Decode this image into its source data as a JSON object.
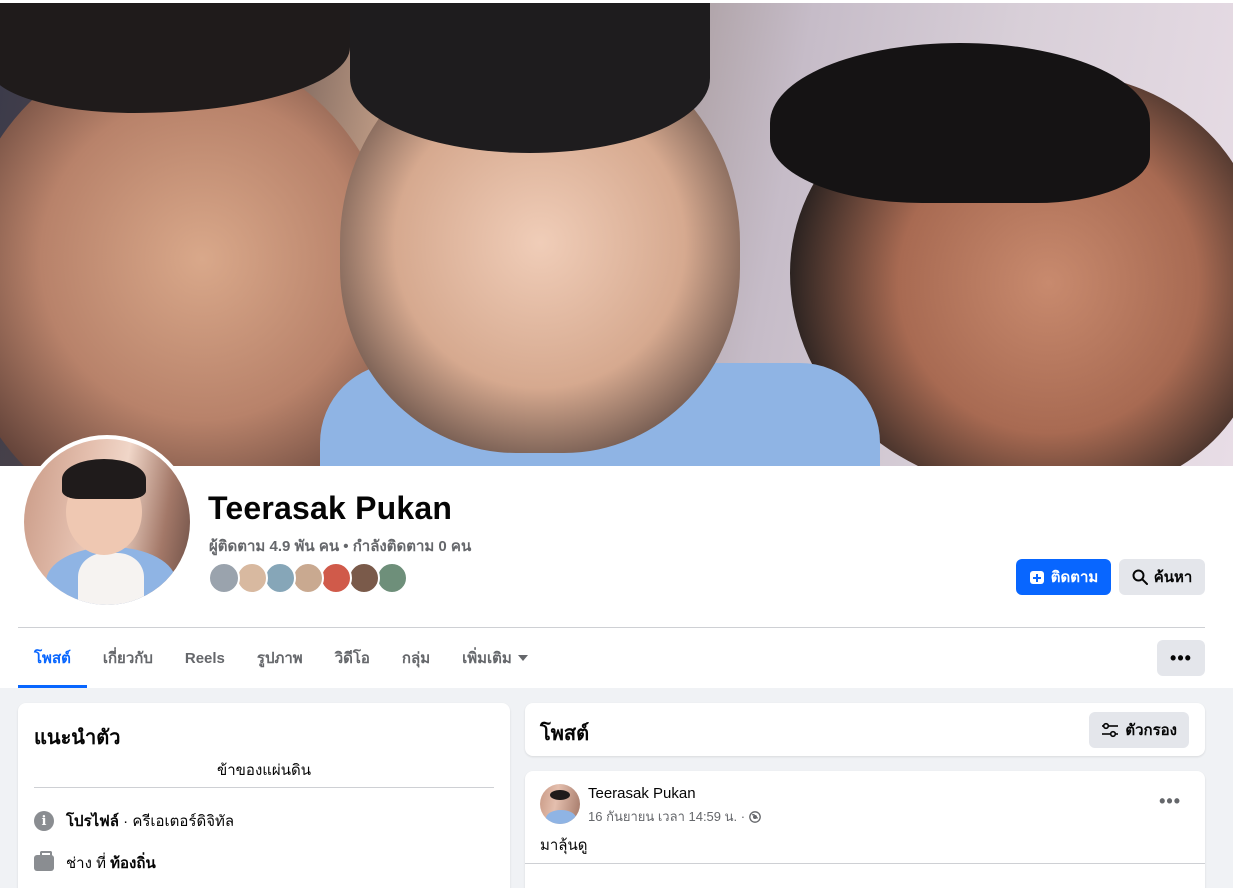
{
  "profile": {
    "name": "Teerasak Pukan",
    "stats": "ผู้ติดตาม 4.9 พัน คน • กำลังติดตาม 0 คน"
  },
  "actions": {
    "follow_label": "ติดตาม",
    "search_label": "ค้นหา",
    "more_label": "•••"
  },
  "tabs": [
    {
      "label": "โพสต์"
    },
    {
      "label": "เกี่ยวกับ"
    },
    {
      "label": "Reels"
    },
    {
      "label": "รูปภาพ"
    },
    {
      "label": "วิดีโอ"
    },
    {
      "label": "กลุ่ม"
    },
    {
      "label": "เพิ่มเติม"
    }
  ],
  "friend_avatar_colors": [
    "#9aa3ad",
    "#d8b9a0",
    "#86a6b8",
    "#c9a990",
    "#d05a4a",
    "#7a5a4a",
    "#6e8f7a"
  ],
  "intro": {
    "title": "แนะนำตัว",
    "bio": "ข้าของแผ่นดิน",
    "profile_label": "โปรไฟล์",
    "profile_value": " · ครีเอเตอร์ดิจิทัล",
    "work_prefix": "ช่าง ที่ ",
    "work_place": "ท้องถิ่น"
  },
  "posts": {
    "title": "โพสต์",
    "filter_label": "ตัวกรอง",
    "items": [
      {
        "author": "Teerasak Pukan",
        "time": "16 กันยายน เวลา 14:59 น. ·",
        "text": "มาลุ้นดู"
      }
    ]
  }
}
